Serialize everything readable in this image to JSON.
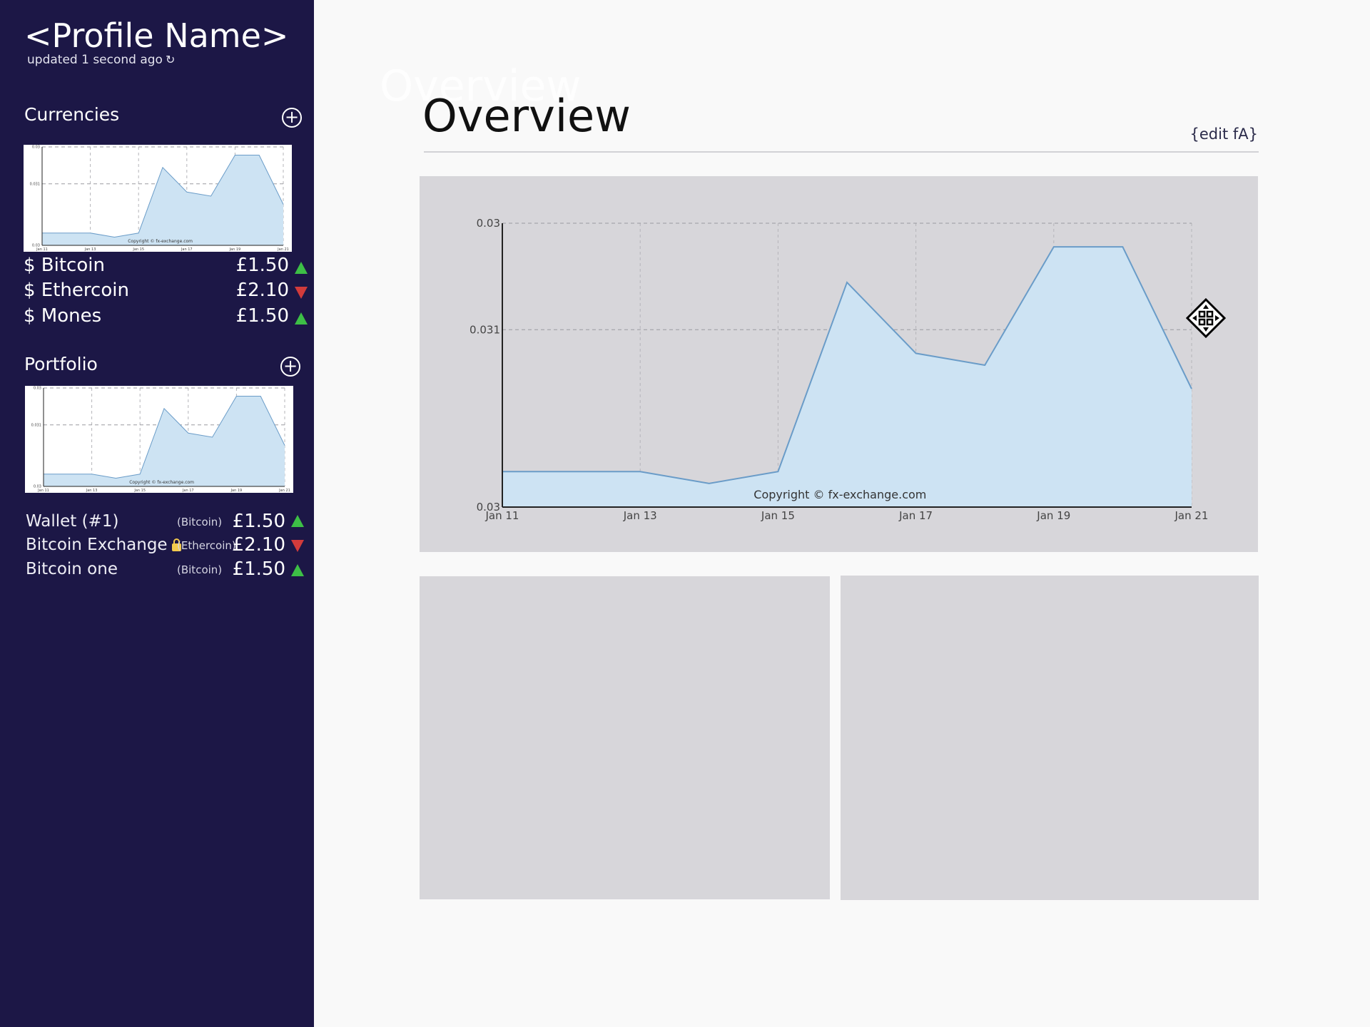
{
  "profile": {
    "name": "<Profile Name>",
    "updated": "updated 1 second ago",
    "refresh_icon": "refresh-icon"
  },
  "currencies": {
    "title": "Currencies",
    "add_icon": "plus-circle-icon",
    "items": [
      {
        "name": "$ Bitcoin",
        "price": "£1.50",
        "trend": "up"
      },
      {
        "name": "$ Ethercoin",
        "price": "£2.10",
        "trend": "down"
      },
      {
        "name": "$ Mones",
        "price": "£1.50",
        "trend": "up"
      }
    ]
  },
  "portfolio": {
    "title": "Portfolio",
    "add_icon": "plus-circle-icon",
    "items": [
      {
        "name": "Wallet (#1)",
        "type": "(Bitcoin)",
        "price": "£1.50",
        "trend": "up",
        "locked": false
      },
      {
        "name": "Bitcoin Exchange",
        "type": "(Ethercoin)",
        "price": "£2.10",
        "trend": "down",
        "locked": true
      },
      {
        "name": "Bitcoin one",
        "type": "(Bitcoin)",
        "price": "£1.50",
        "trend": "up",
        "locked": false
      }
    ]
  },
  "main": {
    "ghost_title": "Overview",
    "title": "Overview",
    "edit_link": "{edit fA}"
  },
  "colors": {
    "sidebar_bg": "#1c1746",
    "up": "#3dbf46",
    "down": "#d23b3b",
    "chart_fill": "#cde3f3",
    "chart_line": "#6a9cc8",
    "panel_bg": "#d7d6da"
  },
  "chart_data": {
    "type": "area",
    "x": [
      "Jan 11",
      "Jan 12",
      "Jan 13",
      "Jan 14",
      "Jan 15",
      "Jan 16",
      "Jan 17",
      "Jan 18",
      "Jan 19",
      "Jan 20",
      "Jan 21"
    ],
    "series": [
      {
        "values": [
          0.0033,
          0.0033,
          0.0033,
          0.0032,
          0.0033,
          0.0049,
          0.0043,
          0.0042,
          0.0052,
          0.0052,
          0.004
        ]
      }
    ],
    "xticks": [
      "Jan 11",
      "Jan 13",
      "Jan 15",
      "Jan 17",
      "Jan 19",
      "Jan 21"
    ],
    "yticks": [
      {
        "value": 0.003,
        "label": "0.03"
      },
      {
        "value": 0.0045,
        "label": "0.031"
      },
      {
        "value": 0.0054,
        "label": "0.03"
      }
    ],
    "ylim": [
      0.003,
      0.0054
    ],
    "grid": true,
    "annotation": "Copyright © fx-exchange.com"
  }
}
